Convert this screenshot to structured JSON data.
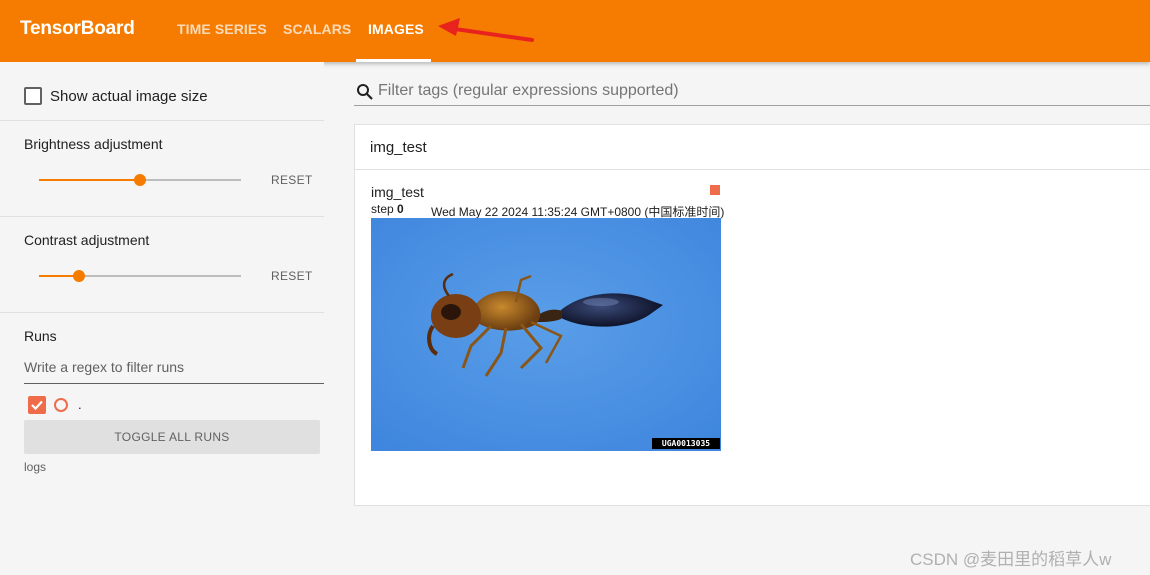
{
  "header": {
    "brand": "TensorBoard",
    "tabs": [
      {
        "label": "TIME SERIES",
        "active": false
      },
      {
        "label": "SCALARS",
        "active": false
      },
      {
        "label": "IMAGES",
        "active": true
      }
    ],
    "accent_color": "#f57c00"
  },
  "sidebar": {
    "show_actual_size_label": "Show actual image size",
    "brightness": {
      "label": "Brightness adjustment",
      "reset_label": "RESET",
      "level": 0.5
    },
    "contrast": {
      "label": "Contrast adjustment",
      "reset_label": "RESET",
      "level": 0.2
    },
    "runs": {
      "title": "Runs",
      "filter_placeholder": "Write a regex to filter runs",
      "run_name": ".",
      "run_color": "#ef6c4a",
      "toggle_label": "TOGGLE ALL RUNS",
      "footer": "logs"
    }
  },
  "main": {
    "filter_placeholder": "Filter tags (regular expressions supported)",
    "card": {
      "title": "img_test",
      "image_title": "img_test",
      "step_label": "step",
      "step_value": "0",
      "timestamp": "Wed May 22 2024 11:35:24 GMT+0800 (中国标准时间)",
      "image_tag": "UGA0013035"
    }
  },
  "watermark": "CSDN @麦田里的稻草人w"
}
